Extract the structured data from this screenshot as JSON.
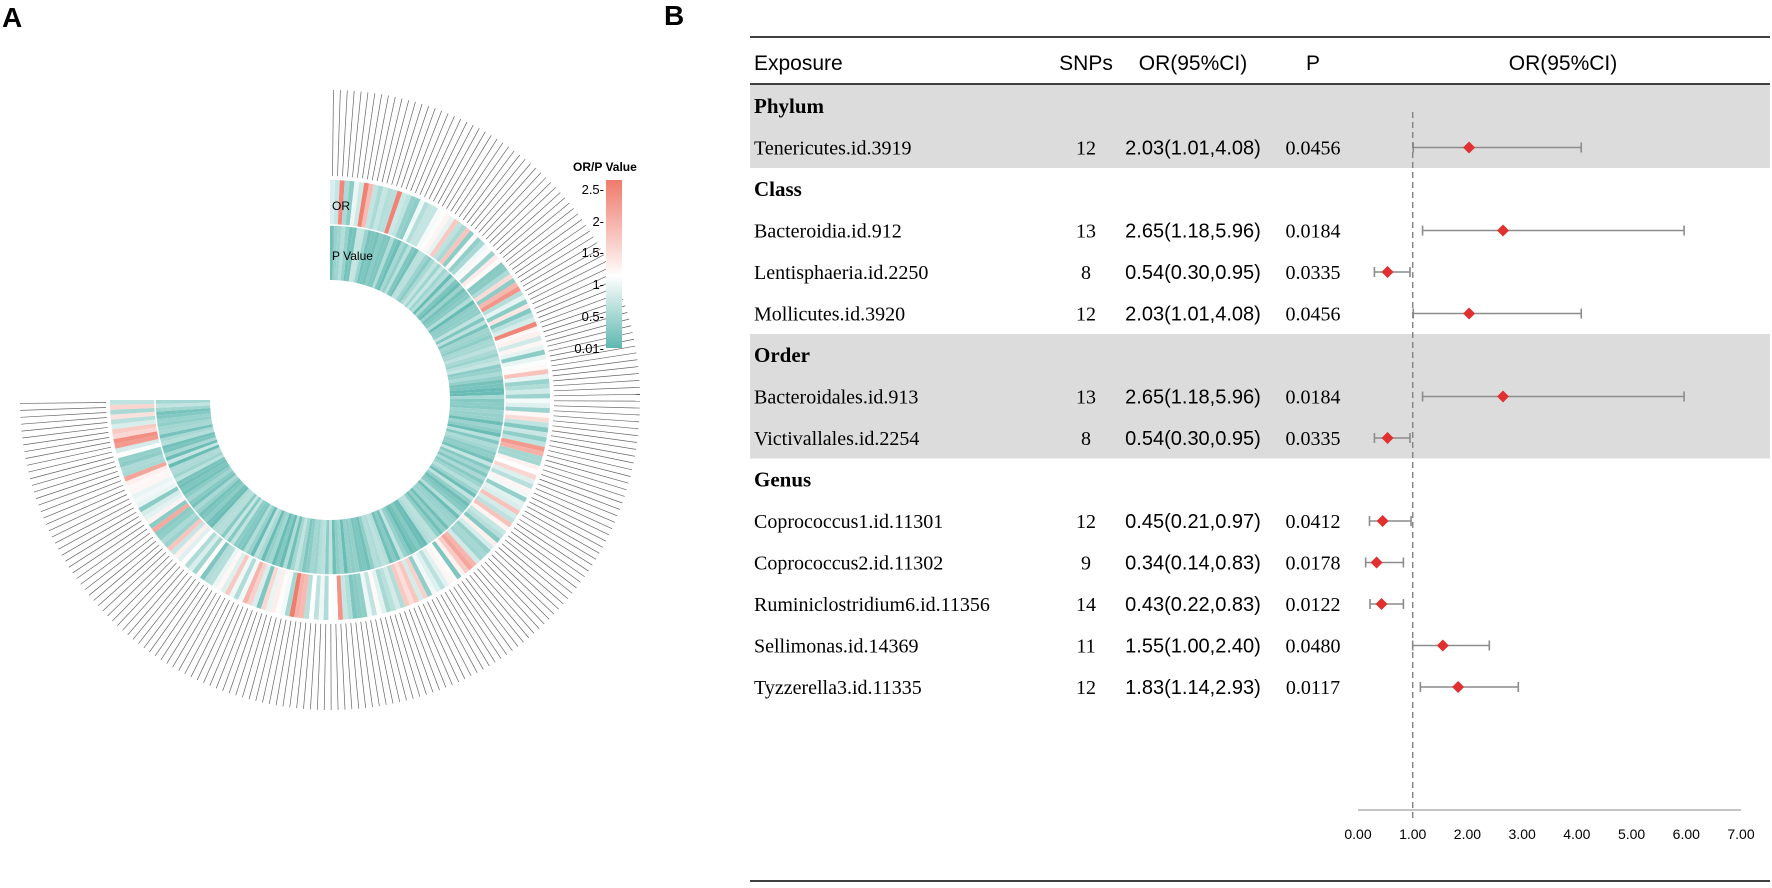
{
  "panel_a": {
    "label": "A",
    "ring_labels": {
      "outer": "OR",
      "inner": "P Value"
    },
    "legend": {
      "title": "OR/P Value",
      "ticks": [
        "2.5-",
        "2-",
        "1.5-",
        "1-",
        "0.5-",
        "0.01-"
      ]
    },
    "colors": {
      "low": "#5fb8b0",
      "mid": "#ffffff",
      "high": "#ef7a6b"
    },
    "taxa_count": 211
  },
  "panel_b": {
    "label": "B",
    "headers": {
      "exposure": "Exposure",
      "snps": "SNPs",
      "or_ci": "OR(95%CI)",
      "p": "P",
      "plot": "OR(95%CI)"
    },
    "groups": [
      "Phylum",
      "Class",
      "Order",
      "Genus"
    ],
    "colors": {
      "shade": "#dcdcdc",
      "marker": "#e03030",
      "whisker": "#8c8c8c",
      "refline": "#888888"
    }
  },
  "chart_data": {
    "type": "forest",
    "xlabel": "",
    "xlim": [
      0,
      7
    ],
    "reference_line": 1.0,
    "x_ticks": [
      "0.00",
      "1.00",
      "2.00",
      "3.00",
      "4.00",
      "5.00",
      "6.00",
      "7.00"
    ],
    "rows": [
      {
        "kind": "group",
        "label": "Phylum",
        "shaded": true
      },
      {
        "kind": "item",
        "exposure": "Tenericutes.id.3919",
        "snps": "12",
        "or_ci": "2.03(1.01,4.08)",
        "p": "0.0456",
        "or": 2.03,
        "lo": 1.01,
        "hi": 4.08,
        "shaded": true
      },
      {
        "kind": "group",
        "label": "Class",
        "shaded": false
      },
      {
        "kind": "item",
        "exposure": "Bacteroidia.id.912",
        "snps": "13",
        "or_ci": "2.65(1.18,5.96)",
        "p": "0.0184",
        "or": 2.65,
        "lo": 1.18,
        "hi": 5.96,
        "shaded": false
      },
      {
        "kind": "item",
        "exposure": "Lentisphaeria.id.2250",
        "snps": "8",
        "or_ci": "0.54(0.30,0.95)",
        "p": "0.0335",
        "or": 0.54,
        "lo": 0.3,
        "hi": 0.95,
        "shaded": false
      },
      {
        "kind": "item",
        "exposure": "Mollicutes.id.3920",
        "snps": "12",
        "or_ci": "2.03(1.01,4.08)",
        "p": "0.0456",
        "or": 2.03,
        "lo": 1.01,
        "hi": 4.08,
        "shaded": false
      },
      {
        "kind": "group",
        "label": "Order",
        "shaded": true
      },
      {
        "kind": "item",
        "exposure": "Bacteroidales.id.913",
        "snps": "13",
        "or_ci": "2.65(1.18,5.96)",
        "p": "0.0184",
        "or": 2.65,
        "lo": 1.18,
        "hi": 5.96,
        "shaded": true
      },
      {
        "kind": "item",
        "exposure": "Victivallales.id.2254",
        "snps": "8",
        "or_ci": "0.54(0.30,0.95)",
        "p": "0.0335",
        "or": 0.54,
        "lo": 0.3,
        "hi": 0.95,
        "shaded": true
      },
      {
        "kind": "group",
        "label": "Genus",
        "shaded": false
      },
      {
        "kind": "item",
        "exposure": "Coprococcus1.id.11301",
        "snps": "12",
        "or_ci": "0.45(0.21,0.97)",
        "p": "0.0412",
        "or": 0.45,
        "lo": 0.21,
        "hi": 0.97,
        "shaded": false
      },
      {
        "kind": "item",
        "exposure": "Coprococcus2.id.11302",
        "snps": "9",
        "or_ci": "0.34(0.14,0.83)",
        "p": "0.0178",
        "or": 0.34,
        "lo": 0.14,
        "hi": 0.83,
        "shaded": false
      },
      {
        "kind": "item",
        "exposure": "Ruminiclostridium6.id.11356",
        "snps": "14",
        "or_ci": "0.43(0.22,0.83)",
        "p": "0.0122",
        "or": 0.43,
        "lo": 0.22,
        "hi": 0.83,
        "shaded": false
      },
      {
        "kind": "item",
        "exposure": "Sellimonas.id.14369",
        "snps": "11",
        "or_ci": "1.55(1.00,2.40)",
        "p": "0.0480",
        "or": 1.55,
        "lo": 1.0,
        "hi": 2.4,
        "shaded": false
      },
      {
        "kind": "item",
        "exposure": "Tyzzerella3.id.11335",
        "snps": "12",
        "or_ci": "1.83(1.14,2.93)",
        "p": "0.0117",
        "or": 1.83,
        "lo": 1.14,
        "hi": 2.93,
        "shaded": false
      }
    ]
  }
}
